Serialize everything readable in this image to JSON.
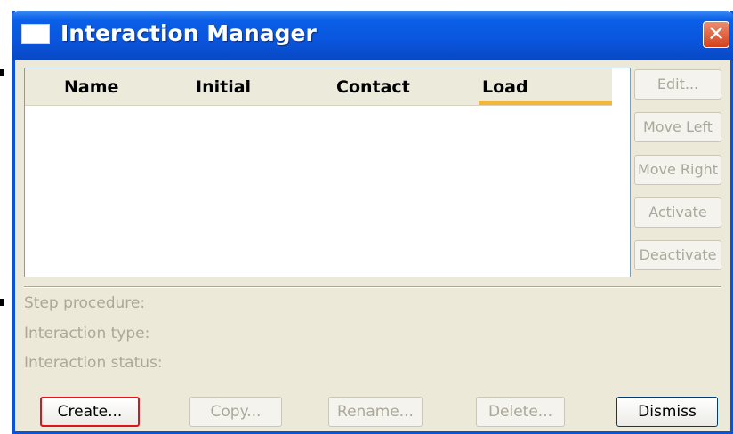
{
  "window": {
    "title": "Interaction Manager",
    "close_glyph": "✕"
  },
  "table": {
    "columns": [
      "Name",
      "Initial",
      "Contact",
      "Load"
    ],
    "rows": []
  },
  "side_buttons": {
    "edit": "Edit...",
    "move_left": "Move Left",
    "move_right": "Move Right",
    "activate": "Activate",
    "deactivate": "Deactivate"
  },
  "status": {
    "step_procedure": "Step procedure:",
    "interaction_type": "Interaction type:",
    "interaction_status": "Interaction status:"
  },
  "bottom_buttons": {
    "create": "Create...",
    "copy": "Copy...",
    "rename": "Rename...",
    "delete": "Delete...",
    "dismiss": "Dismiss"
  },
  "colors": {
    "titlebar": "#0a55dd",
    "highlight_border": "#e0121b",
    "load_accent": "#f4b63a"
  }
}
